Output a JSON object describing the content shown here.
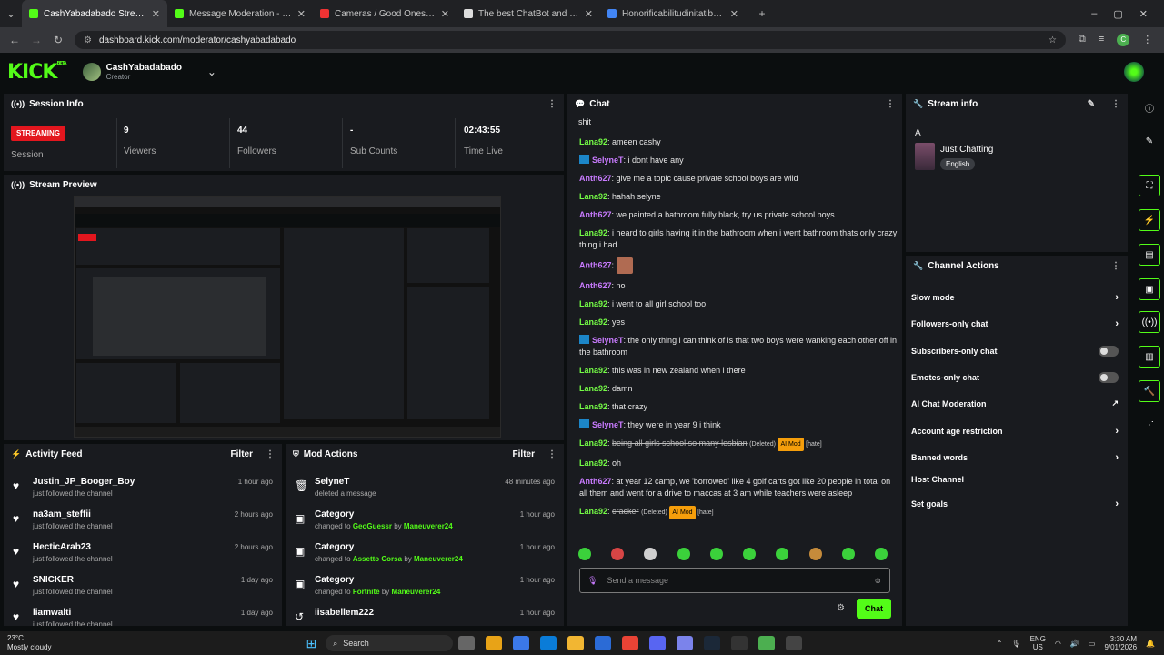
{
  "browser": {
    "tabs": [
      {
        "title": "CashYabadabado Stream - Kick",
        "active": true,
        "color": "#53fc18"
      },
      {
        "title": "Message Moderation - Kick Da",
        "active": false,
        "color": "#53fc18"
      },
      {
        "title": "Cameras / Good Ones Go I",
        "active": false,
        "color": "#e33"
      },
      {
        "title": "The best ChatBot and Widgets",
        "active": false,
        "color": "#ddd"
      },
      {
        "title": "Honorificabilitudinitatibus - Go",
        "active": false,
        "color": "#4285f4"
      }
    ],
    "url": "dashboard.kick.com/moderator/cashyabadabado"
  },
  "header": {
    "logo": "KICK",
    "logo_sup": "BETA",
    "channel_name": "CashYabadabado",
    "role": "Creator"
  },
  "session": {
    "title": "Session Info",
    "status": "STREAMING",
    "status_label": "Session",
    "stats": [
      {
        "value": "9",
        "label": "Viewers"
      },
      {
        "value": "44",
        "label": "Followers"
      },
      {
        "value": "-",
        "label": "Sub Counts"
      },
      {
        "value": "02:43:55",
        "label": "Time Live"
      }
    ]
  },
  "preview": {
    "title": "Stream Preview"
  },
  "activity": {
    "title": "Activity Feed",
    "filter": "Filter",
    "items": [
      {
        "name": "Justin_JP_Booger_Boy",
        "sub": "just followed the channel",
        "time": "1 hour ago"
      },
      {
        "name": "na3am_steffii",
        "sub": "just followed the channel",
        "time": "2 hours ago"
      },
      {
        "name": "HecticArab23",
        "sub": "just followed the channel",
        "time": "2 hours ago"
      },
      {
        "name": "SNICKER",
        "sub": "just followed the channel",
        "time": "1 day ago"
      },
      {
        "name": "liamwalti",
        "sub": "just followed the channel",
        "time": "1 day ago"
      }
    ]
  },
  "mod": {
    "title": "Mod Actions",
    "filter": "Filter",
    "items": [
      {
        "name": "SelyneT",
        "pre": "deleted a message",
        "target": "",
        "by": "",
        "mod": "",
        "time": "48 minutes ago",
        "icon": "trash"
      },
      {
        "name": "Category",
        "pre": "changed to",
        "target": "GeoGuessr",
        "by": "by",
        "mod": "Maneuverer24",
        "time": "1 hour ago",
        "icon": "category"
      },
      {
        "name": "Category",
        "pre": "changed to",
        "target": "Assetto Corsa",
        "by": "by",
        "mod": "Maneuverer24",
        "time": "1 hour ago",
        "icon": "category"
      },
      {
        "name": "Category",
        "pre": "changed to",
        "target": "Fortnite",
        "by": "by",
        "mod": "Maneuverer24",
        "time": "1 hour ago",
        "icon": "category"
      },
      {
        "name": "iisabellem222",
        "pre": "",
        "target": "",
        "by": "",
        "mod": "",
        "time": "1 hour ago",
        "icon": "undo"
      }
    ]
  },
  "chat": {
    "title": "Chat",
    "top_text": "shit",
    "messages": [
      {
        "user": "Lana92",
        "cls": "l",
        "badge": false,
        "text": "ameen cashy"
      },
      {
        "user": "SelyneT",
        "cls": "s",
        "badge": true,
        "text": "i dont have any"
      },
      {
        "user": "Anth627",
        "cls": "a",
        "badge": false,
        "text": "give me a topic cause private school boys are wild"
      },
      {
        "user": "Lana92",
        "cls": "l",
        "badge": false,
        "text": "hahah selyne"
      },
      {
        "user": "Anth627",
        "cls": "a",
        "badge": false,
        "text": "we painted a bathroom fully black, try us private school boys"
      },
      {
        "user": "Lana92",
        "cls": "l",
        "badge": false,
        "text": "i heard to girls having it in the bathroom when i went bathroom thats only crazy thing i had"
      },
      {
        "user": "Anth627",
        "cls": "a",
        "badge": false,
        "text": "",
        "emote": true
      },
      {
        "user": "Anth627",
        "cls": "a",
        "badge": false,
        "text": "no"
      },
      {
        "user": "Lana92",
        "cls": "l",
        "badge": false,
        "text": "i went to all girl school too"
      },
      {
        "user": "Lana92",
        "cls": "l",
        "badge": false,
        "text": "yes"
      },
      {
        "user": "SelyneT",
        "cls": "s",
        "badge": true,
        "text": "the only thing i can think of is that two boys were wanking each other off in the bathroom"
      },
      {
        "user": "Lana92",
        "cls": "l",
        "badge": false,
        "text": "this was in new zealand when i there"
      },
      {
        "user": "Lana92",
        "cls": "l",
        "badge": false,
        "text": "damn"
      },
      {
        "user": "Lana92",
        "cls": "l",
        "badge": false,
        "text": "that crazy"
      },
      {
        "user": "SelyneT",
        "cls": "s",
        "badge": true,
        "text": "they were in year 9 i think"
      },
      {
        "user": "Lana92",
        "cls": "l",
        "badge": false,
        "text": "being all girls school so many lesbian",
        "deleted": true
      },
      {
        "user": "Lana92",
        "cls": "l",
        "badge": false,
        "text": "oh"
      },
      {
        "user": "Anth627",
        "cls": "a",
        "badge": false,
        "text": "at year 12 camp, we 'borrowed' like 4 golf carts got like 20 people in total on all them and went for a drive to maccas at 3 am while teachers were asleep"
      },
      {
        "user": "Lana92",
        "cls": "l",
        "badge": false,
        "text": "cracker",
        "deleted": true
      }
    ],
    "deleted_label": "(Deleted)",
    "ai_mod": "AI Mod",
    "hate": "[hate]",
    "placeholder": "Send a message",
    "send": "Chat"
  },
  "stream_info": {
    "title": "Stream info",
    "letter": "A",
    "category": "Just Chatting",
    "language": "English"
  },
  "channel_actions": {
    "title": "Channel Actions",
    "items": [
      {
        "label": "Slow mode",
        "ctrl": "arrow"
      },
      {
        "label": "Followers-only chat",
        "ctrl": "arrow"
      },
      {
        "label": "Subscribers-only chat",
        "ctrl": "toggle"
      },
      {
        "label": "Emotes-only chat",
        "ctrl": "toggle"
      },
      {
        "label": "AI Chat Moderation",
        "ctrl": "external"
      },
      {
        "label": "Account age restriction",
        "ctrl": "arrow"
      },
      {
        "label": "Banned words",
        "ctrl": "arrow"
      },
      {
        "label": "Host Channel",
        "ctrl": "none"
      },
      {
        "label": "Set goals",
        "ctrl": "arrow"
      }
    ]
  },
  "taskbar": {
    "temp": "23°C",
    "weather": "Mostly cloudy",
    "search": "Search",
    "lang": "ENG",
    "region": "US",
    "time": "3:30 AM",
    "date": "9/01/2026"
  }
}
